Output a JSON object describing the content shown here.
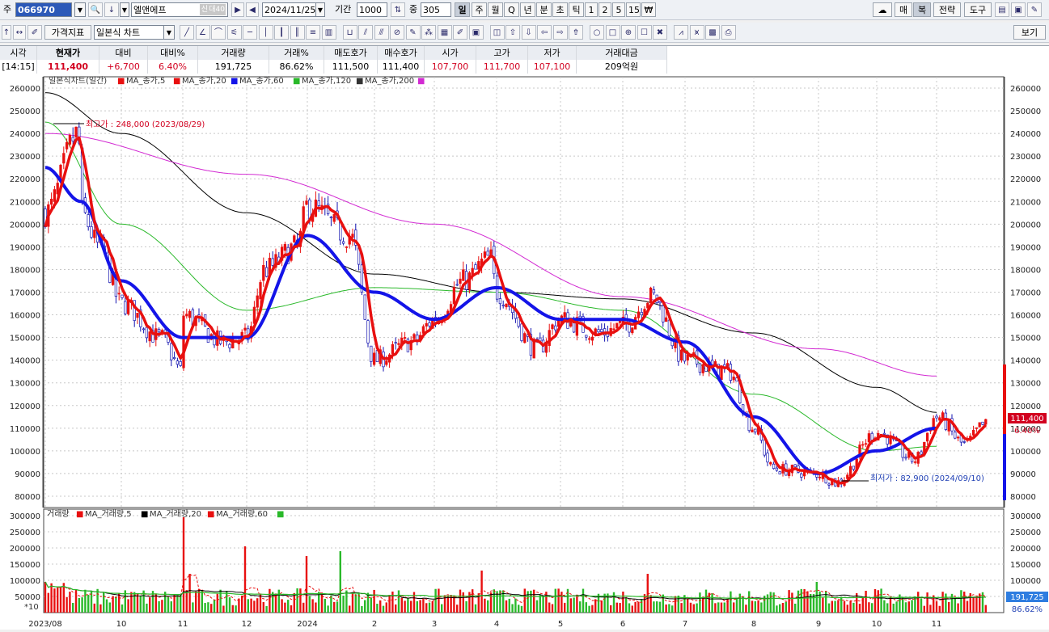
{
  "toolbar": {
    "market_label": "주",
    "stock_code": "066970",
    "stock_name": "엘앤에프",
    "credit_badge": "신",
    "margin_badge": "대40",
    "date": "2024/11/25",
    "period_label": "기간",
    "period_value": "1000",
    "count_label": "중",
    "count_value": "305",
    "timeframes": [
      "일",
      "주",
      "월",
      "Q",
      "년",
      "분",
      "초",
      "틱",
      "1",
      "2",
      "5",
      "15",
      "₩"
    ],
    "right_buttons": [
      "매",
      "복",
      "전략",
      "도구"
    ],
    "price_indicator": "가격지표",
    "chart_type": "일본식 차트",
    "view_button": "보기"
  },
  "quote": {
    "headers": [
      "시각",
      "현재가",
      "대비",
      "대비%",
      "거래량",
      "거래%",
      "매도호가",
      "매수호가",
      "시가",
      "고가",
      "저가",
      "거래대금"
    ],
    "values": [
      "[14:15]",
      "111,400",
      "+6,700",
      "6.40%",
      "191,725",
      "86.62%",
      "111,500",
      "111,400",
      "107,700",
      "111,700",
      "107,100",
      "209억원"
    ]
  },
  "price_panel": {
    "title": "일본식차트(일간)",
    "legend": [
      {
        "label": "MA_종가,5",
        "color": "#e81010"
      },
      {
        "label": "MA_종가,20",
        "color": "#e81010"
      },
      {
        "label": "MA_종가,60",
        "color": "#1414e8"
      },
      {
        "label": "MA_종가,120",
        "color": "#2ab92a"
      },
      {
        "label": "MA_종가,200",
        "color": "#d22ad2"
      }
    ],
    "high_annotation": "최고가 : 248,000 (2023/08/29)",
    "low_annotation": "최저가 : 82,900 (2024/09/10)",
    "current_price_tag": "111,400",
    "current_change_tag": "6.40%",
    "y_ticks": [
      "260000",
      "250000",
      "240000",
      "230000",
      "220000",
      "210000",
      "200000",
      "190000",
      "180000",
      "170000",
      "160000",
      "150000",
      "140000",
      "130000",
      "120000",
      "110000",
      "100000",
      "90000",
      "80000"
    ]
  },
  "volume_panel": {
    "title": "거래량",
    "legend": [
      {
        "label": "MA_거래량,5",
        "color": "#e81010"
      },
      {
        "label": "MA_거래량,20",
        "color": "#000000"
      },
      {
        "label": "MA_거래량,60",
        "color": "#2ab92a"
      }
    ],
    "y_ticks": [
      "300000",
      "250000",
      "200000",
      "150000",
      "100000",
      "50000"
    ],
    "multiplier": "*10",
    "current_volume_tag": "191,725",
    "volume_ratio_tag": "86.62%"
  },
  "x_axis": {
    "labels": [
      "2023/08",
      "10",
      "11",
      "12",
      "2024",
      "2",
      "3",
      "4",
      "5",
      "6",
      "7",
      "8",
      "9",
      "10",
      "11"
    ]
  },
  "chart_data": {
    "type": "candlestick",
    "title": "일본식차트(일간)",
    "ylim": [
      75000,
      265000
    ],
    "high": {
      "value": 248000,
      "date": "2023/08/29"
    },
    "low": {
      "value": 82900,
      "date": "2024/09/10"
    },
    "close_path": [
      {
        "date": "2023/08",
        "close": 205000
      },
      {
        "date": "2023/08/29",
        "close": 240000
      },
      {
        "date": "2023/09",
        "close": 205000
      },
      {
        "date": "2023/09/15",
        "close": 190000
      },
      {
        "date": "2023/10",
        "close": 165000
      },
      {
        "date": "2023/10/20",
        "close": 150000
      },
      {
        "date": "2023/10/31",
        "close": 135000
      },
      {
        "date": "2023/11",
        "close": 160000
      },
      {
        "date": "2023/11/20",
        "close": 148000
      },
      {
        "date": "2023/12",
        "close": 150000
      },
      {
        "date": "2023/12/10",
        "close": 180000
      },
      {
        "date": "2023/12/26",
        "close": 190000
      },
      {
        "date": "2024/01",
        "close": 208000
      },
      {
        "date": "2024/01/20",
        "close": 195000
      },
      {
        "date": "2024/02",
        "close": 140000
      },
      {
        "date": "2024/02/20",
        "close": 148000
      },
      {
        "date": "2024/03",
        "close": 158000
      },
      {
        "date": "2024/03/15",
        "close": 175000
      },
      {
        "date": "2024/03/28",
        "close": 185000
      },
      {
        "date": "2024/04",
        "close": 170000
      },
      {
        "date": "2024/04/20",
        "close": 145000
      },
      {
        "date": "2024/05",
        "close": 158000
      },
      {
        "date": "2024/05/20",
        "close": 152000
      },
      {
        "date": "2024/06",
        "close": 155000
      },
      {
        "date": "2024/06/15",
        "close": 168000
      },
      {
        "date": "2024/07",
        "close": 140000
      },
      {
        "date": "2024/07/20",
        "close": 135000
      },
      {
        "date": "2024/08",
        "close": 110000
      },
      {
        "date": "2024/08/10",
        "close": 92000
      },
      {
        "date": "2024/09",
        "close": 90000
      },
      {
        "date": "2024/09/10",
        "close": 86000
      },
      {
        "date": "2024/10",
        "close": 108000
      },
      {
        "date": "2024/10/20",
        "close": 96000
      },
      {
        "date": "2024/11",
        "close": 115000
      },
      {
        "date": "2024/11/15",
        "close": 103000
      },
      {
        "date": "2024/11/25",
        "close": 111400
      }
    ],
    "ma60_path": [
      {
        "date": "2023/08",
        "value": 225000
      },
      {
        "date": "2023/09",
        "value": 210000
      },
      {
        "date": "2023/10",
        "value": 175000
      },
      {
        "date": "2023/11",
        "value": 150000
      },
      {
        "date": "2023/12",
        "value": 150000
      },
      {
        "date": "2024/01",
        "value": 195000
      },
      {
        "date": "2024/02",
        "value": 170000
      },
      {
        "date": "2024/03",
        "value": 158000
      },
      {
        "date": "2024/04",
        "value": 172000
      },
      {
        "date": "2024/05",
        "value": 158000
      },
      {
        "date": "2024/06",
        "value": 158000
      },
      {
        "date": "2024/07",
        "value": 148000
      },
      {
        "date": "2024/08",
        "value": 115000
      },
      {
        "date": "2024/09",
        "value": 90000
      },
      {
        "date": "2024/10",
        "value": 100000
      },
      {
        "date": "2024/11",
        "value": 110000
      }
    ],
    "ma120_path": [
      {
        "date": "2023/08",
        "value": 245000
      },
      {
        "date": "2023/10",
        "value": 200000
      },
      {
        "date": "2023/12",
        "value": 162000
      },
      {
        "date": "2024/02",
        "value": 172000
      },
      {
        "date": "2024/04",
        "value": 170000
      },
      {
        "date": "2024/06",
        "value": 162000
      },
      {
        "date": "2024/08",
        "value": 125000
      },
      {
        "date": "2024/10",
        "value": 100000
      },
      {
        "date": "2024/11",
        "value": 102000
      }
    ],
    "ma200_path": [
      {
        "date": "2023/08",
        "value": 240000
      },
      {
        "date": "2023/12",
        "value": 222000
      },
      {
        "date": "2024/03",
        "value": 200000
      },
      {
        "date": "2024/06",
        "value": 168000
      },
      {
        "date": "2024/09",
        "value": 145000
      },
      {
        "date": "2024/11",
        "value": 133000
      }
    ],
    "black_ma_path": [
      {
        "date": "2023/08",
        "value": 258000
      },
      {
        "date": "2023/10",
        "value": 240000
      },
      {
        "date": "2023/12",
        "value": 205000
      },
      {
        "date": "2024/02",
        "value": 178000
      },
      {
        "date": "2024/04",
        "value": 170000
      },
      {
        "date": "2024/06",
        "value": 167000
      },
      {
        "date": "2024/08",
        "value": 152000
      },
      {
        "date": "2024/10",
        "value": 128000
      },
      {
        "date": "2024/11",
        "value": 117000
      }
    ]
  }
}
